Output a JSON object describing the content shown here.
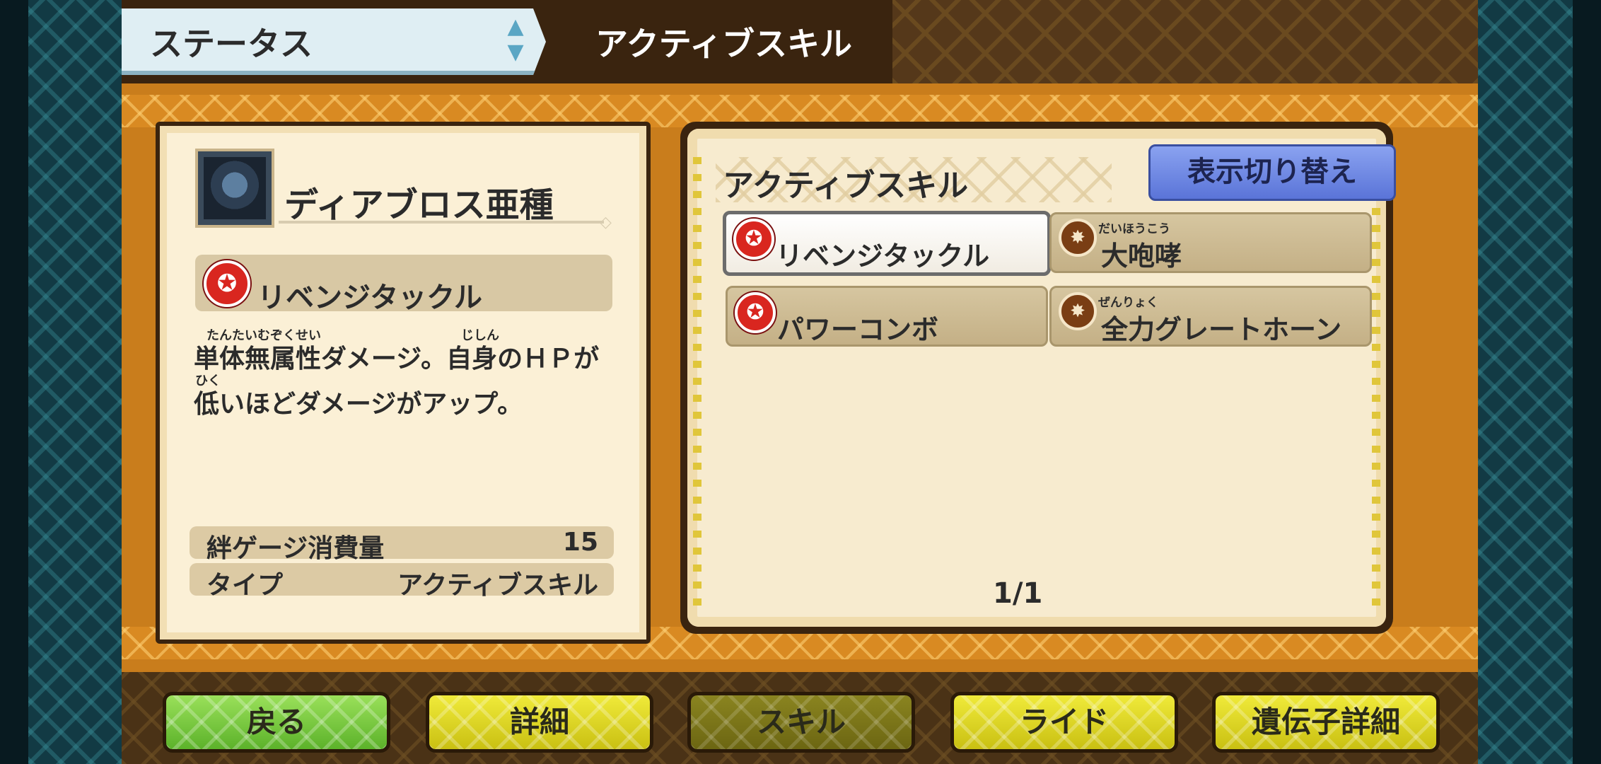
{
  "header": {
    "status_tab_label": "ステータス",
    "title": "アクティブスキル"
  },
  "monster": {
    "name": "ディアブロス亜種",
    "icon": "monster-portrait"
  },
  "selected_skill": {
    "name": "リベンジタックル",
    "icon": "attack-icon-red",
    "description_line1": "単体無属性ダメージ。自身のＨＰが",
    "description_line2": "低いほどダメージがアップ。",
    "ruby_1": "たんたいむぞくせい",
    "ruby_2": "じしん",
    "ruby_3": "ひく"
  },
  "stats": [
    {
      "label": "絆ゲージ消費量",
      "value": "15"
    },
    {
      "label": "タイプ",
      "value": "アクティブスキル"
    }
  ],
  "panel": {
    "title": "アクティブスキル",
    "toggle_label": "表示切り替え",
    "page": "1/1",
    "skills": [
      {
        "label": "リベンジタックル",
        "icon": "attack-icon-red",
        "ruby": "",
        "selected": true
      },
      {
        "label": "大咆哮",
        "icon": "roar-icon-brown",
        "ruby": "だいほうこう",
        "selected": false
      },
      {
        "label": "パワーコンボ",
        "icon": "attack-icon-red",
        "ruby": "",
        "selected": false
      },
      {
        "label": "全力グレートホーン",
        "icon": "roar-icon-brown",
        "ruby": "ぜんりょく",
        "selected": false
      }
    ]
  },
  "nav": {
    "back": "戻る",
    "details": "詳細",
    "skill": "スキル",
    "ride": "ライド",
    "gene_details": "遺伝子詳細"
  },
  "colors": {
    "frame_orange": "#c97d1c",
    "dark_brown": "#3a240f",
    "toggle_blue": "#5a74d8",
    "nav_yellow": "#f0ea3a",
    "nav_green": "#5cb22a",
    "skill_red": "#d9261f"
  }
}
